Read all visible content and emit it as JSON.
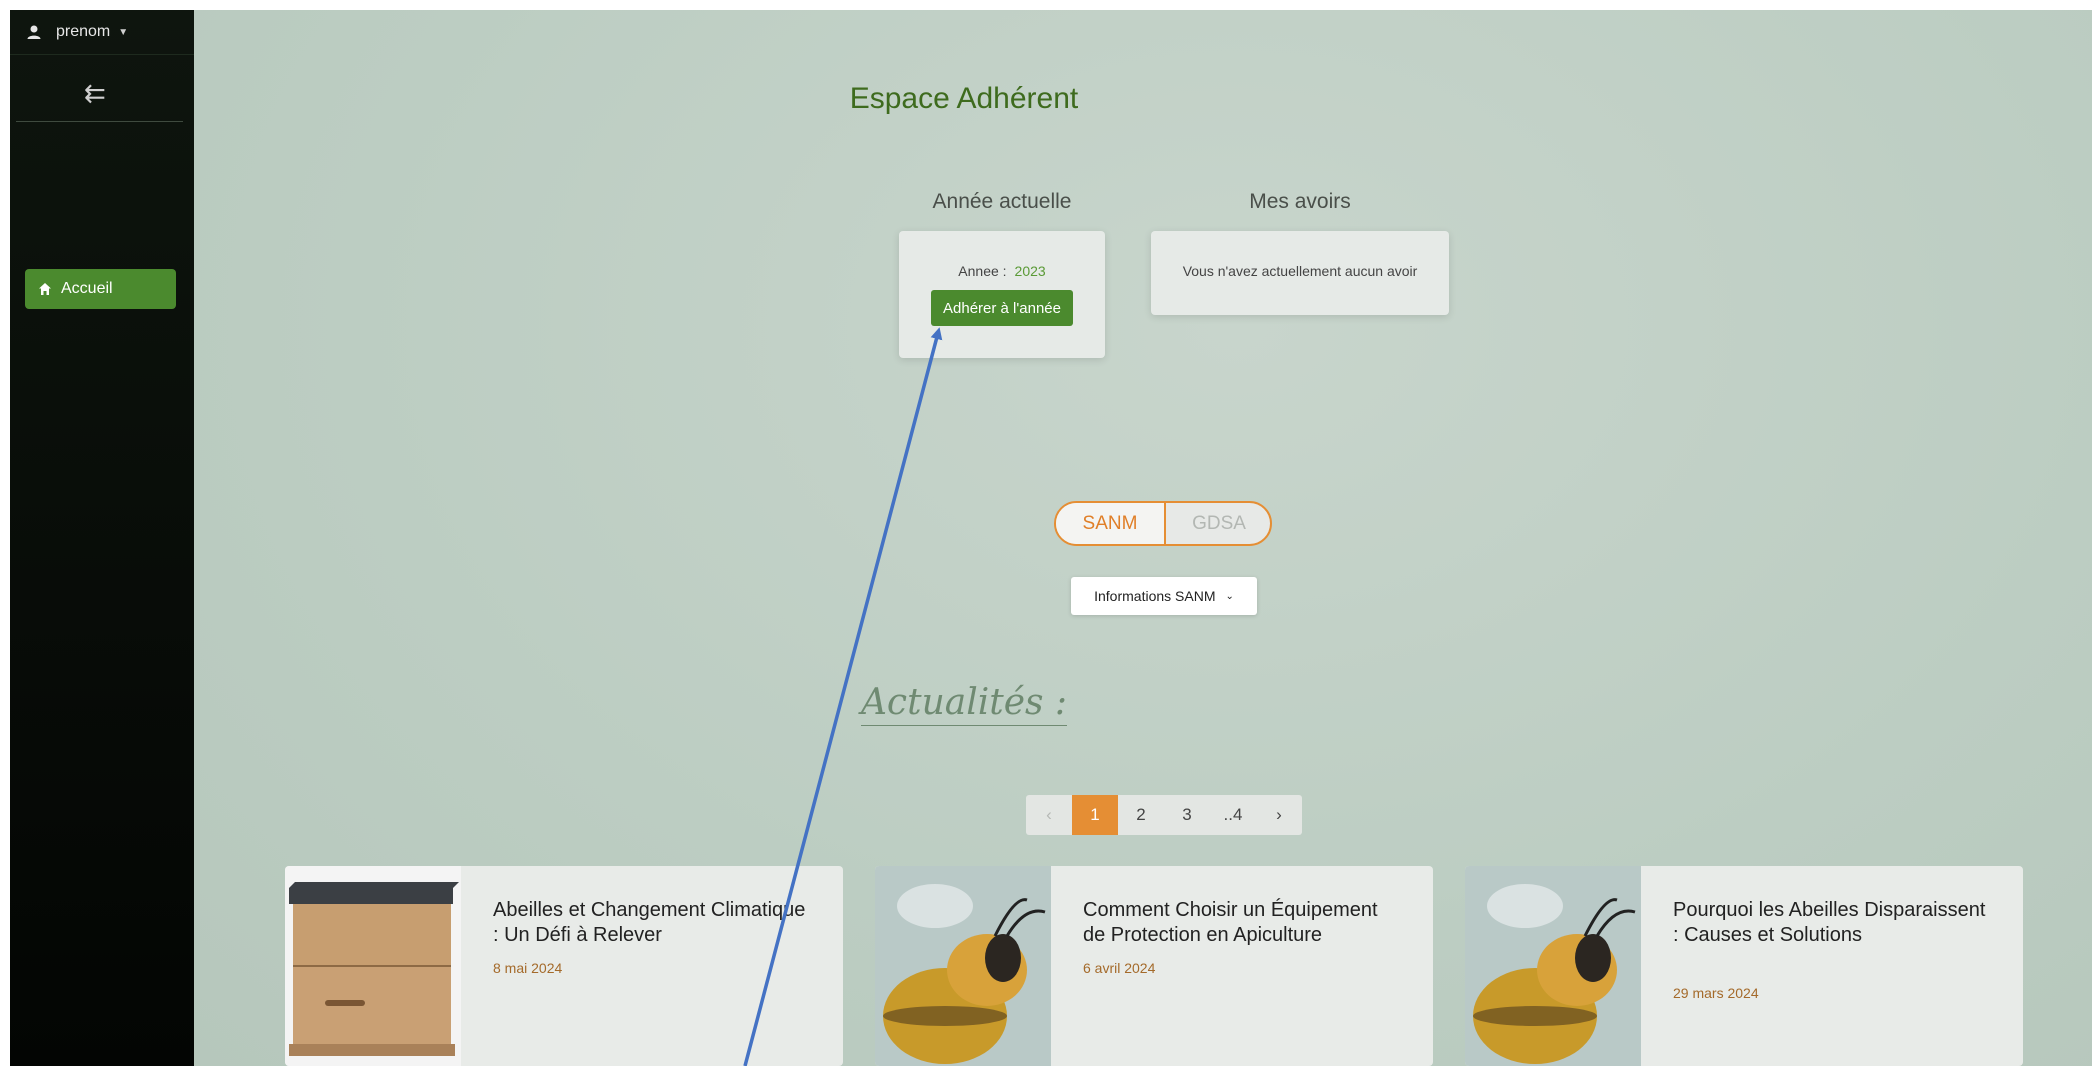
{
  "sidebar": {
    "user_name": "prenom",
    "nav_items": [
      {
        "label": "Accueil"
      }
    ]
  },
  "main": {
    "title": "Espace Adhérent",
    "current_year": {
      "heading": "Année actuelle",
      "year_label": "Annee :",
      "year_value": "2023",
      "join_button": "Adhérer à l'année"
    },
    "credits": {
      "heading": "Mes avoirs",
      "empty_text": "Vous n'avez actuellement aucun avoir"
    },
    "toggle": {
      "options": [
        "SANM",
        "GDSA"
      ],
      "selected": "SANM"
    },
    "info_dropdown": {
      "label": "Informations SANM"
    },
    "news": {
      "heading": "Actualités :",
      "pagination": {
        "pages": [
          "1",
          "2",
          "3",
          "..4"
        ],
        "current": "1"
      },
      "articles": [
        {
          "title": "Abeilles et Changement Climatique : Un Défi à Relever",
          "date": "8 mai 2024",
          "image": "beehive"
        },
        {
          "title": "Comment Choisir un Équipement de Protection en Apiculture",
          "date": "6 avril 2024",
          "image": "bee"
        },
        {
          "title": "Pourquoi les Abeilles Disparaissent : Causes et Solutions",
          "date": "29 mars 2024",
          "image": "bee"
        }
      ]
    }
  },
  "annotation": {
    "color": "#4472c4",
    "points_to": "join-button"
  },
  "colors": {
    "sidebar_bg": "#050805",
    "primary_green": "#4b8a2e",
    "accent_orange": "#e58e34",
    "title_green": "#3e6b1e",
    "date_brown": "#a46a2a"
  }
}
